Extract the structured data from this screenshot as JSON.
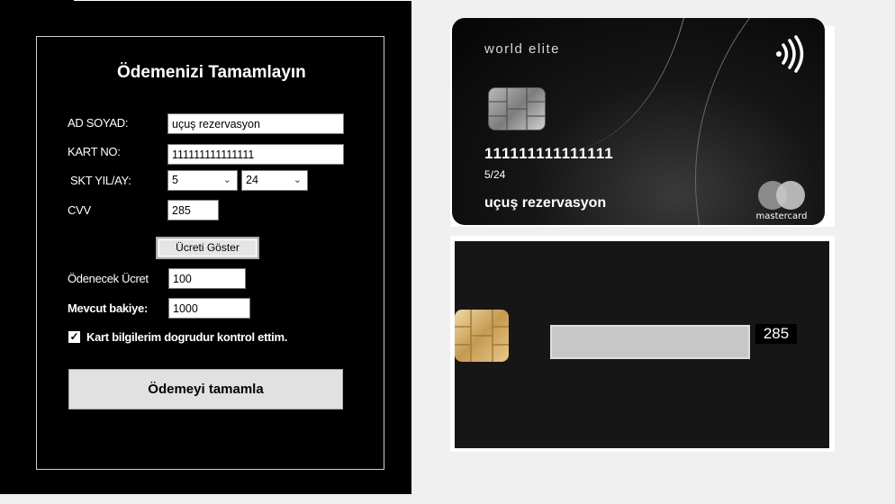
{
  "form": {
    "heading": "Ödemenizi Tamamlayın",
    "name_label": "AD SOYAD:",
    "name_value": "uçuş rezervasyon",
    "card_no_label": "KART NO:",
    "card_no_value": "111111111111111",
    "expiry_label": "SKT YIL/AY:",
    "expiry_month": "5",
    "expiry_year": "24",
    "cvv_label": "CVV",
    "cvv_value": "285",
    "show_fee_button": "Ücreti Göster",
    "fee_label": "Ödenecek Ücret",
    "fee_value": "100",
    "balance_label": "Mevcut bakiye:",
    "balance_value": "1000",
    "confirm_checkbox_label": "Kart bilgilerim dogrudur kontrol ettim.",
    "confirm_checked": true,
    "submit_button": "Ödemeyi tamamla"
  },
  "card_front": {
    "brand_text": "world elite",
    "number": "111111111111111",
    "expiry": "5/24",
    "holder": "uçuş rezervasyon",
    "network_label": "mastercard",
    "icons": [
      "contactless-icon",
      "chip-icon",
      "mastercard-logo"
    ]
  },
  "card_back": {
    "cvv": "285",
    "icons": [
      "chip-icon"
    ]
  }
}
